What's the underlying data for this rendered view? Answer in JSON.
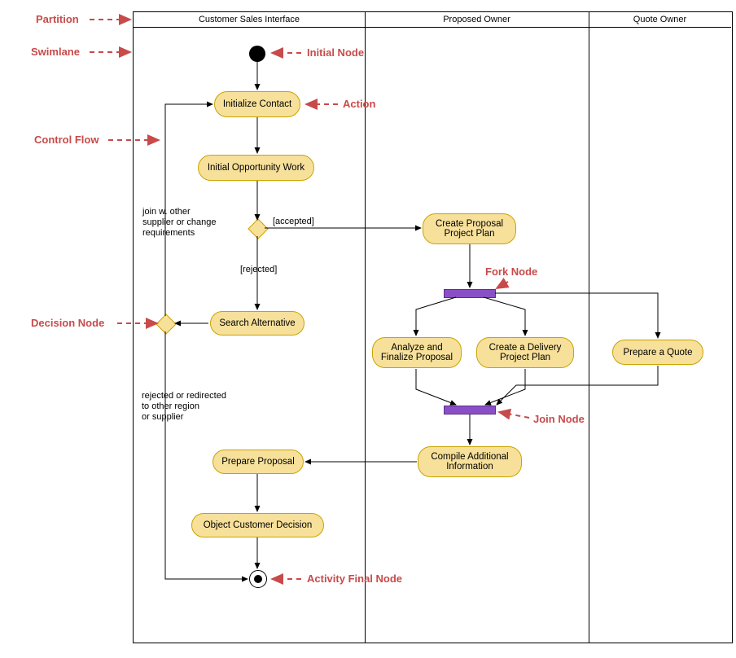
{
  "lanes": {
    "l1": "Customer Sales Interface",
    "l2": "Proposed Owner",
    "l3": "Quote Owner"
  },
  "actions": {
    "act1": "Initialize Contact",
    "act2": "Initial Opportunity Work",
    "act3": "Create Proposal\nProject Plan",
    "act4": "Search Alternative",
    "act5": "Analyze and\nFinalize Proposal",
    "act6": "Create a Delivery\nProject Plan",
    "act7": "Prepare a Quote",
    "act8": "Compile Additional\nInformation",
    "act9": "Prepare Proposal",
    "act10": "Object Customer Decision"
  },
  "guards": {
    "accepted": "[accepted]",
    "rejected": "[rejected]",
    "joinReq": "join w. other\nsupplier or change\nrequirements",
    "redirect": "rejected or redirected\nto other region\nor supplier"
  },
  "annotations": {
    "partition": "Partition",
    "swimlane": "Swimlane",
    "controlFlow": "Control Flow",
    "decisionNode": "Decision Node",
    "initialNode": "Initial Node",
    "action": "Action",
    "forkNode": "Fork Node",
    "joinNode": "Join Node",
    "activityFinal": "Activity Final Node"
  },
  "chart_data": {
    "type": "uml_activity_diagram",
    "title": "",
    "partitions": [
      {
        "id": "P1",
        "name": "Customer Sales Interface"
      },
      {
        "id": "P2",
        "name": "Proposed Owner"
      },
      {
        "id": "P3",
        "name": "Quote Owner"
      }
    ],
    "nodes": [
      {
        "id": "N0",
        "type": "initial",
        "partition": "P1"
      },
      {
        "id": "A1",
        "type": "action",
        "label": "Initialize Contact",
        "partition": "P1"
      },
      {
        "id": "A2",
        "type": "action",
        "label": "Initial Opportunity Work",
        "partition": "P1"
      },
      {
        "id": "D1",
        "type": "decision",
        "partition": "P1"
      },
      {
        "id": "A3",
        "type": "action",
        "label": "Create Proposal Project Plan",
        "partition": "P2"
      },
      {
        "id": "F1",
        "type": "fork",
        "partition": "P2"
      },
      {
        "id": "A4",
        "type": "action",
        "label": "Search Alternative",
        "partition": "P1"
      },
      {
        "id": "D2",
        "type": "decision",
        "partition": "P1"
      },
      {
        "id": "A5",
        "type": "action",
        "label": "Analyze and Finalize Proposal",
        "partition": "P2"
      },
      {
        "id": "A6",
        "type": "action",
        "label": "Create a Delivery Project Plan",
        "partition": "P2"
      },
      {
        "id": "A7",
        "type": "action",
        "label": "Prepare a Quote",
        "partition": "P3"
      },
      {
        "id": "J1",
        "type": "join",
        "partition": "P2"
      },
      {
        "id": "A8",
        "type": "action",
        "label": "Compile Additional Information",
        "partition": "P2"
      },
      {
        "id": "A9",
        "type": "action",
        "label": "Prepare Proposal",
        "partition": "P1"
      },
      {
        "id": "A10",
        "type": "action",
        "label": "Object Customer Decision",
        "partition": "P1"
      },
      {
        "id": "NF",
        "type": "final",
        "partition": "P1"
      }
    ],
    "edges": [
      {
        "from": "N0",
        "to": "A1"
      },
      {
        "from": "A1",
        "to": "A2"
      },
      {
        "from": "A2",
        "to": "D1"
      },
      {
        "from": "D1",
        "to": "A3",
        "guard": "[accepted]"
      },
      {
        "from": "D1",
        "to": "A4",
        "guard": "[rejected]"
      },
      {
        "from": "A3",
        "to": "F1"
      },
      {
        "from": "F1",
        "to": "A5"
      },
      {
        "from": "F1",
        "to": "A6"
      },
      {
        "from": "F1",
        "to": "A7"
      },
      {
        "from": "A4",
        "to": "D2"
      },
      {
        "from": "D2",
        "to": "A1",
        "guard": "join w. other supplier or change requirements"
      },
      {
        "from": "D2",
        "to": "NF",
        "guard": "rejected or redirected to other region or supplier"
      },
      {
        "from": "A5",
        "to": "J1"
      },
      {
        "from": "A6",
        "to": "J1"
      },
      {
        "from": "A7",
        "to": "J1"
      },
      {
        "from": "J1",
        "to": "A8"
      },
      {
        "from": "A8",
        "to": "A9"
      },
      {
        "from": "A9",
        "to": "A10"
      },
      {
        "from": "A10",
        "to": "NF"
      }
    ],
    "annotations_callouts": [
      {
        "target": "partition-header",
        "label": "Partition"
      },
      {
        "target": "partition-divider",
        "label": "Swimlane"
      },
      {
        "target": "edge",
        "label": "Control Flow"
      },
      {
        "target": "D2",
        "label": "Decision Node"
      },
      {
        "target": "N0",
        "label": "Initial Node"
      },
      {
        "target": "A1",
        "label": "Action"
      },
      {
        "target": "F1",
        "label": "Fork Node"
      },
      {
        "target": "J1",
        "label": "Join Node"
      },
      {
        "target": "NF",
        "label": "Activity Final Node"
      }
    ]
  }
}
